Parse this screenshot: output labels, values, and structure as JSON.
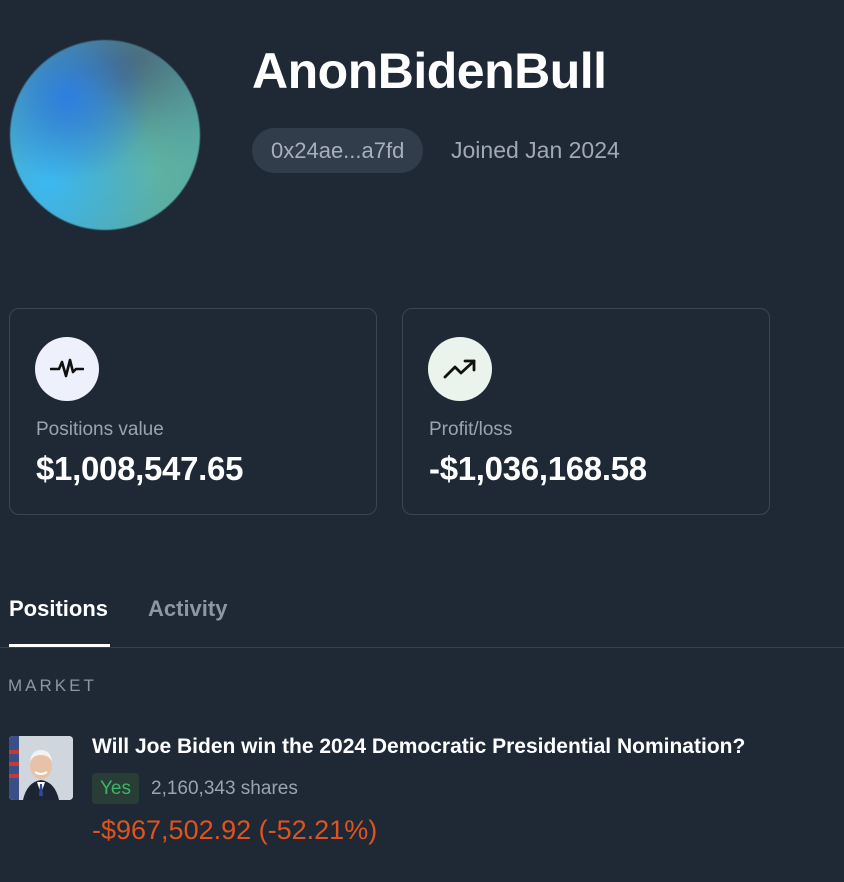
{
  "profile": {
    "username": "AnonBidenBull",
    "address": "0x24ae...a7fd",
    "joined": "Joined Jan 2024",
    "avatar_icon": "gradient-avatar"
  },
  "stats": [
    {
      "icon": "activity-pulse-icon",
      "label": "Positions value",
      "value": "$1,008,547.65"
    },
    {
      "icon": "trending-up-icon",
      "label": "Profit/loss",
      "value": "-$1,036,168.58"
    }
  ],
  "tabs": [
    {
      "label": "Positions",
      "active": true
    },
    {
      "label": "Activity",
      "active": false
    }
  ],
  "market_section": {
    "header": "MARKET",
    "items": [
      {
        "thumb_icon": "joe-biden-portrait",
        "title": "Will Joe Biden win the 2024 Democratic Presidential Nomination?",
        "outcome": "Yes",
        "shares": "2,160,343 shares",
        "pnl": "-$967,502.92 (-52.21%)"
      }
    ]
  },
  "colors": {
    "background": "#1f2936",
    "card_border": "#3a4554",
    "positive": "#3fb468",
    "negative": "#e0531f",
    "muted_text": "#9aa3ae"
  }
}
